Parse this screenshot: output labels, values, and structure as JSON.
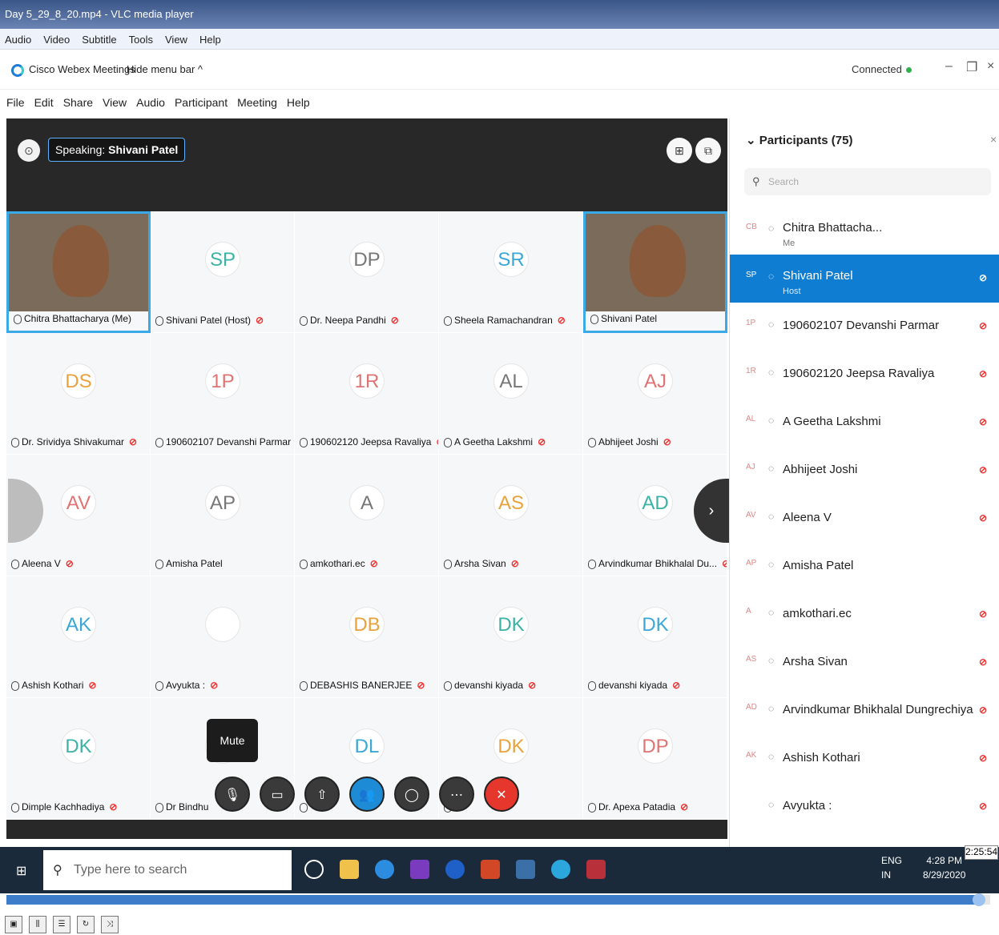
{
  "window": {
    "title": "Day 5_29_8_20.mp4 - VLC media player"
  },
  "vlc_menu": [
    "Audio",
    "Video",
    "Subtitle",
    "Tools",
    "View",
    "Help"
  ],
  "webex": {
    "app_name": "Cisco Webex Meetings",
    "hide_menu": "Hide menu bar ^",
    "connected": "Connected",
    "menu": [
      "File",
      "Edit",
      "Share",
      "View",
      "Audio",
      "Participant",
      "Meeting",
      "Help"
    ]
  },
  "stage": {
    "speaking_label": "Speaking:",
    "speaking_name": "Shivani Patel",
    "tiles": [
      {
        "initials": "",
        "name": "Chitra Bhattacharya (Me)",
        "muted": false,
        "video": true
      },
      {
        "initials": "SP",
        "name": "Shivani Patel (Host)",
        "muted": true,
        "color": "#3bb3a4"
      },
      {
        "initials": "DP",
        "name": "Dr. Neepa Pandhi",
        "muted": true,
        "color": "#777777"
      },
      {
        "initials": "SR",
        "name": "Sheela Ramachandran",
        "muted": true,
        "color": "#3aa7d6"
      },
      {
        "initials": "",
        "name": "Shivani Patel",
        "muted": false,
        "video": true
      },
      {
        "initials": "DS",
        "name": "Dr. Srividya Shivakumar",
        "muted": true,
        "color": "#e9a23b"
      },
      {
        "initials": "1P",
        "name": "190602107 Devanshi Parmar",
        "muted": true,
        "color": "#e07373"
      },
      {
        "initials": "1R",
        "name": "190602120 Jeepsa Ravaliya",
        "muted": true,
        "color": "#e07373"
      },
      {
        "initials": "AL",
        "name": "A Geetha Lakshmi",
        "muted": true,
        "color": "#777777"
      },
      {
        "initials": "AJ",
        "name": "Abhijeet Joshi",
        "muted": true,
        "color": "#e07373"
      },
      {
        "initials": "AV",
        "name": "Aleena V",
        "muted": true,
        "color": "#e07373"
      },
      {
        "initials": "AP",
        "name": "Amisha Patel",
        "muted": false,
        "color": "#777777"
      },
      {
        "initials": "A",
        "name": "amkothari.ec",
        "muted": true,
        "color": "#777777"
      },
      {
        "initials": "AS",
        "name": "Arsha Sivan",
        "muted": true,
        "color": "#e9a23b"
      },
      {
        "initials": "AD",
        "name": "Arvindkumar Bhikhalal Du...",
        "muted": true,
        "color": "#3bb3a4"
      },
      {
        "initials": "AK",
        "name": "Ashish Kothari",
        "muted": true,
        "color": "#3aa7d6"
      },
      {
        "initials": "",
        "name": "Avyukta :",
        "muted": true,
        "color": "#aaaaaa"
      },
      {
        "initials": "DB",
        "name": "DEBASHIS BANERJEE",
        "muted": true,
        "color": "#e9a23b"
      },
      {
        "initials": "DK",
        "name": "devanshi kiyada",
        "muted": true,
        "color": "#3bb3a4"
      },
      {
        "initials": "DK",
        "name": "devanshi kiyada",
        "muted": true,
        "color": "#3aa7d6"
      },
      {
        "initials": "DK",
        "name": "Dimple Kachhadiya",
        "muted": true,
        "color": "#3bb3a4"
      },
      {
        "initials": "",
        "name": "Dr Bindhu",
        "muted": false,
        "color": "#777777"
      },
      {
        "initials": "DL",
        "name": "",
        "muted": false,
        "color": "#3aa7d6"
      },
      {
        "initials": "DK",
        "name": "",
        "muted": false,
        "color": "#e9a23b"
      },
      {
        "initials": "DP",
        "name": "Dr. Apexa Patadia",
        "muted": true,
        "color": "#e07373"
      }
    ],
    "mute_tooltip": "Mute"
  },
  "participants": {
    "title": "Participants (75)",
    "search_placeholder": "Search",
    "items": [
      {
        "initials": "CB",
        "name": "Chitra Bhattacha...",
        "sub": "Me",
        "muted": false
      },
      {
        "initials": "SP",
        "name": "Shivani Patel",
        "sub": "Host",
        "muted": true,
        "host": true
      },
      {
        "initials": "1P",
        "name": "190602107 Devanshi Parmar",
        "sub": "",
        "muted": true
      },
      {
        "initials": "1R",
        "name": "190602120 Jeepsa Ravaliya",
        "sub": "",
        "muted": true
      },
      {
        "initials": "AL",
        "name": "A Geetha Lakshmi",
        "sub": "",
        "muted": true
      },
      {
        "initials": "AJ",
        "name": "Abhijeet Joshi",
        "sub": "",
        "muted": true
      },
      {
        "initials": "AV",
        "name": "Aleena V",
        "sub": "",
        "muted": true
      },
      {
        "initials": "AP",
        "name": "Amisha Patel",
        "sub": "",
        "muted": false
      },
      {
        "initials": "A",
        "name": "amkothari.ec",
        "sub": "",
        "muted": true
      },
      {
        "initials": "AS",
        "name": "Arsha Sivan",
        "sub": "",
        "muted": true
      },
      {
        "initials": "AD",
        "name": "Arvindkumar Bhikhalal Dungrechiya",
        "sub": "",
        "muted": true
      },
      {
        "initials": "AK",
        "name": "Ashish Kothari",
        "sub": "",
        "muted": true
      },
      {
        "initials": "",
        "name": "Avyukta :",
        "sub": "",
        "muted": true
      }
    ]
  },
  "taskbar": {
    "search_placeholder": "Type here to search",
    "lang": "ENG",
    "region": "IN",
    "time": "4:28 PM",
    "date": "8/29/2020"
  },
  "player": {
    "timestamp": "2:25:54",
    "progress": 0.99
  }
}
